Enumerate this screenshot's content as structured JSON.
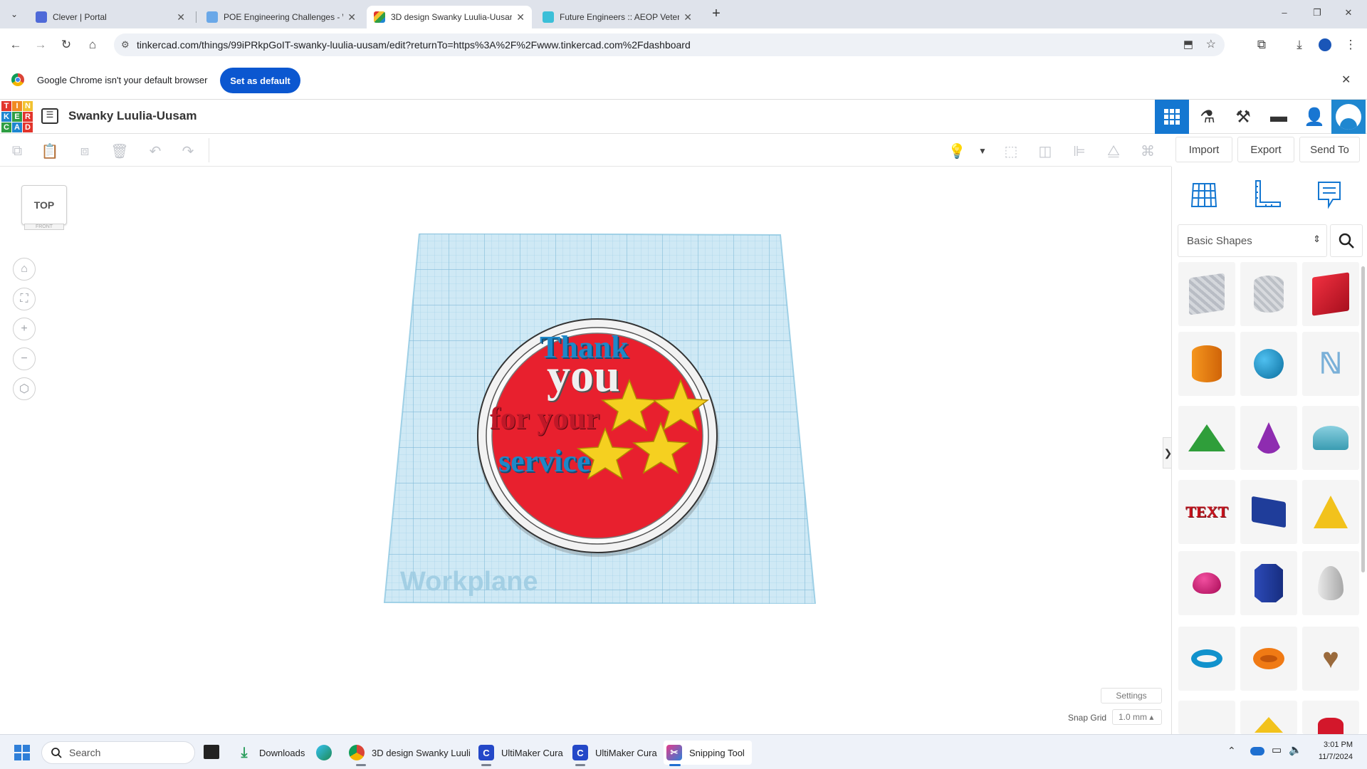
{
  "browser": {
    "tabs": [
      {
        "title": "Clever | Portal",
        "favicon_color": "#4f6ad8",
        "favicon_glyph": "C"
      },
      {
        "title": "POE Engineering Challenges - \\",
        "favicon_color": "#6aa8e8",
        "favicon_glyph": "P"
      },
      {
        "title": "3D design Swanky Luulia-Uusar",
        "favicon_color": "#e8a33c",
        "favicon_glyph": "▦"
      },
      {
        "title": "Future Engineers :: AEOP Veter",
        "favicon_color": "#3bbfd8",
        "favicon_glyph": "▤"
      }
    ],
    "new_tab": "+",
    "url": "tinkercad.com/things/99iPRkpGoIT-swanky-luulia-uusam/edit?returnTo=https%3A%2F%2Fwww.tinkercad.com%2Fdashboard",
    "infobar_text": "Google Chrome isn't your default browser",
    "infobar_button": "Set as default",
    "window_controls": [
      "–",
      "❐",
      "✕"
    ]
  },
  "app": {
    "logo_letters": [
      "T",
      "I",
      "N",
      "K",
      "E",
      "R",
      "C",
      "A",
      "D"
    ],
    "logo_colors": [
      "#e2352c",
      "#f08a24",
      "#f2c230",
      "#1f87d0",
      "#2f9e44",
      "#e2352c",
      "#2f9e44",
      "#1f87d0",
      "#e2352c"
    ],
    "design_title": "Swanky Luulia-Uusam",
    "header_icons": [
      "grid-view-icon",
      "sim-lab-icon",
      "build-tools-icon",
      "bricks-icon",
      "user-add-icon",
      "avatar-icon"
    ],
    "toolbar_buttons": [
      "Import",
      "Export",
      "Send To"
    ],
    "viewcube_label": "TOP",
    "viewcube_under": "FRONT",
    "workplane_label": "Workplane",
    "design_text": {
      "line1": "Thank",
      "line2": "you",
      "line3": "for your",
      "line4": "service"
    },
    "settings_label": "Settings",
    "snap_grid_label": "Snap Grid",
    "snap_grid_value": "1.0 mm ▴",
    "panel_expand": "❯"
  },
  "panel": {
    "category": "Basic Shapes",
    "shapes": [
      {
        "name": "box-hole",
        "color": "#b8bcc4"
      },
      {
        "name": "cylinder-hole",
        "color": "#c4c7cc"
      },
      {
        "name": "box",
        "color": "#d3172b"
      },
      {
        "name": "cylinder",
        "color": "#f07a14"
      },
      {
        "name": "sphere",
        "color": "#1491c8"
      },
      {
        "name": "scribble",
        "color": "#7ab0d8"
      },
      {
        "name": "roof",
        "color": "#2f9e3a"
      },
      {
        "name": "cone",
        "color": "#8e2cb0"
      },
      {
        "name": "round-roof",
        "color": "#4fb4c8"
      },
      {
        "name": "text",
        "color": "#c8141e"
      },
      {
        "name": "wedge",
        "color": "#1f3d9a"
      },
      {
        "name": "pyramid",
        "color": "#f2c21c"
      },
      {
        "name": "half-sphere",
        "color": "#e0177a"
      },
      {
        "name": "polygon",
        "color": "#203a9c"
      },
      {
        "name": "paraboloid",
        "color": "#c8c8c8"
      },
      {
        "name": "torus",
        "color": "#1192cc"
      },
      {
        "name": "tube",
        "color": "#f07a14"
      },
      {
        "name": "heart",
        "color": "#9a6a3c"
      }
    ]
  },
  "taskbar": {
    "search_placeholder": "Search",
    "items": [
      {
        "label": "Downloads"
      },
      {
        "label": "3D design Swanky Luuli"
      },
      {
        "label": "UltiMaker Cura"
      },
      {
        "label": "UltiMaker Cura"
      },
      {
        "label": "Snipping Tool"
      }
    ],
    "time": "3:01 PM",
    "date": "11/7/2024"
  }
}
